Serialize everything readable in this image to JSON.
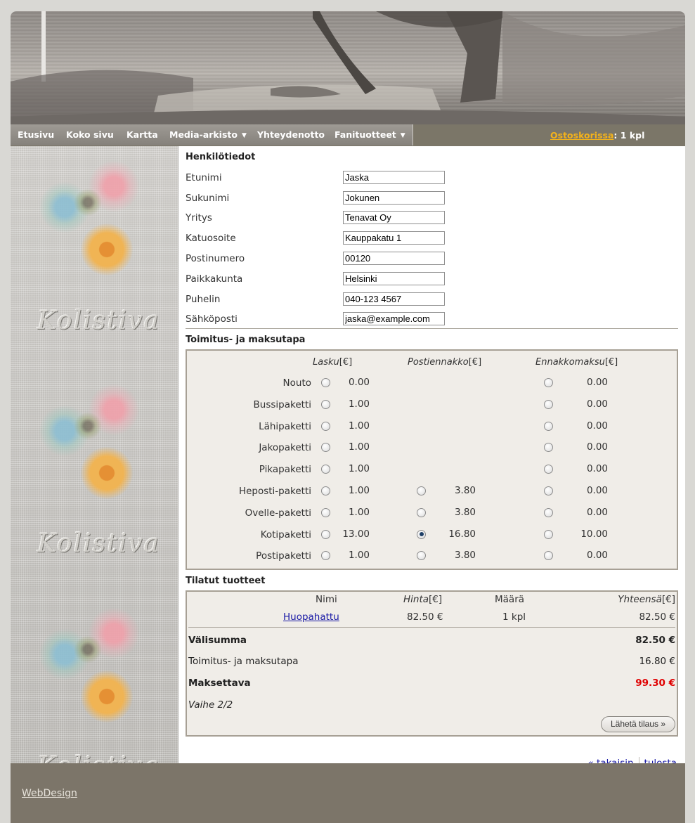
{
  "nav": {
    "items": [
      {
        "label": "Etusivu",
        "dropdown": false
      },
      {
        "label": "Koko sivu",
        "dropdown": false
      },
      {
        "label": "Kartta",
        "dropdown": false
      },
      {
        "label": "Media-arkisto",
        "dropdown": true
      },
      {
        "label": "Yhteydenotto",
        "dropdown": false
      },
      {
        "label": "Fanituotteet",
        "dropdown": true
      }
    ],
    "cart_link": "Ostoskorissa",
    "cart_sep": ":",
    "cart_count": "1 kpl"
  },
  "sidebar": {
    "logo_text": "Kolistiva"
  },
  "personal": {
    "title": "Henkilötiedot",
    "fields": [
      {
        "label": "Etunimi",
        "value": "Jaska"
      },
      {
        "label": "Sukunimi",
        "value": "Jokunen"
      },
      {
        "label": "Yritys",
        "value": "Tenavat Oy"
      },
      {
        "label": "Katuosoite",
        "value": "Kauppakatu 1"
      },
      {
        "label": "Postinumero",
        "value": "00120"
      },
      {
        "label": "Paikkakunta",
        "value": "Helsinki"
      },
      {
        "label": "Puhelin",
        "value": "040-123 4567"
      },
      {
        "label": "Sähköposti",
        "value": "jaska@example.com"
      }
    ]
  },
  "delivery": {
    "title": "Toimitus- ja maksutapa",
    "columns": [
      {
        "name": "Lasku",
        "unit": "[€]"
      },
      {
        "name": "Postiennakko",
        "unit": "[€]"
      },
      {
        "name": "Ennakkomaksu",
        "unit": "[€]"
      }
    ],
    "rows": [
      {
        "label": "Nouto",
        "lasku": "0.00",
        "postiennakko": null,
        "ennakko": "0.00",
        "selected": null
      },
      {
        "label": "Bussipaketti",
        "lasku": "1.00",
        "postiennakko": null,
        "ennakko": "0.00",
        "selected": null
      },
      {
        "label": "Lähipaketti",
        "lasku": "1.00",
        "postiennakko": null,
        "ennakko": "0.00",
        "selected": null
      },
      {
        "label": "Jakopaketti",
        "lasku": "1.00",
        "postiennakko": null,
        "ennakko": "0.00",
        "selected": null
      },
      {
        "label": "Pikapaketti",
        "lasku": "1.00",
        "postiennakko": null,
        "ennakko": "0.00",
        "selected": null
      },
      {
        "label": "Heposti-paketti",
        "lasku": "1.00",
        "postiennakko": "3.80",
        "ennakko": "0.00",
        "selected": null
      },
      {
        "label": "Ovelle-paketti",
        "lasku": "1.00",
        "postiennakko": "3.80",
        "ennakko": "0.00",
        "selected": null
      },
      {
        "label": "Kotipaketti",
        "lasku": "13.00",
        "postiennakko": "16.80",
        "ennakko": "10.00",
        "selected": "postiennakko"
      },
      {
        "label": "Postipaketti",
        "lasku": "1.00",
        "postiennakko": "3.80",
        "ennakko": "0.00",
        "selected": null
      }
    ]
  },
  "products": {
    "title": "Tilatut tuotteet",
    "headers": {
      "name": "Nimi",
      "price": "Hinta",
      "price_unit": "[€]",
      "qty": "Määrä",
      "total": "Yhteensä",
      "total_unit": "[€]"
    },
    "items": [
      {
        "name": "Huopahattu",
        "price": "82.50 €",
        "qty": "1 kpl",
        "total": "82.50 €"
      }
    ],
    "subtotal_label": "Välisumma",
    "subtotal_value": "82.50 €",
    "delivery_label": "Toimitus- ja maksutapa",
    "delivery_value": "16.80 €",
    "payable_label": "Maksettava",
    "payable_value": "99.30 €",
    "step": "Vaihe 2/2",
    "submit_label": "Lähetä tilaus »"
  },
  "links": {
    "back": "« takaisin",
    "print": "tulosta"
  },
  "footer": {
    "link": "WebDesign"
  },
  "colors": {
    "accent": "#f3b21b",
    "payable": "#e00000",
    "nav_bg": "#7b7668",
    "footer_bg": "#7c7569"
  }
}
